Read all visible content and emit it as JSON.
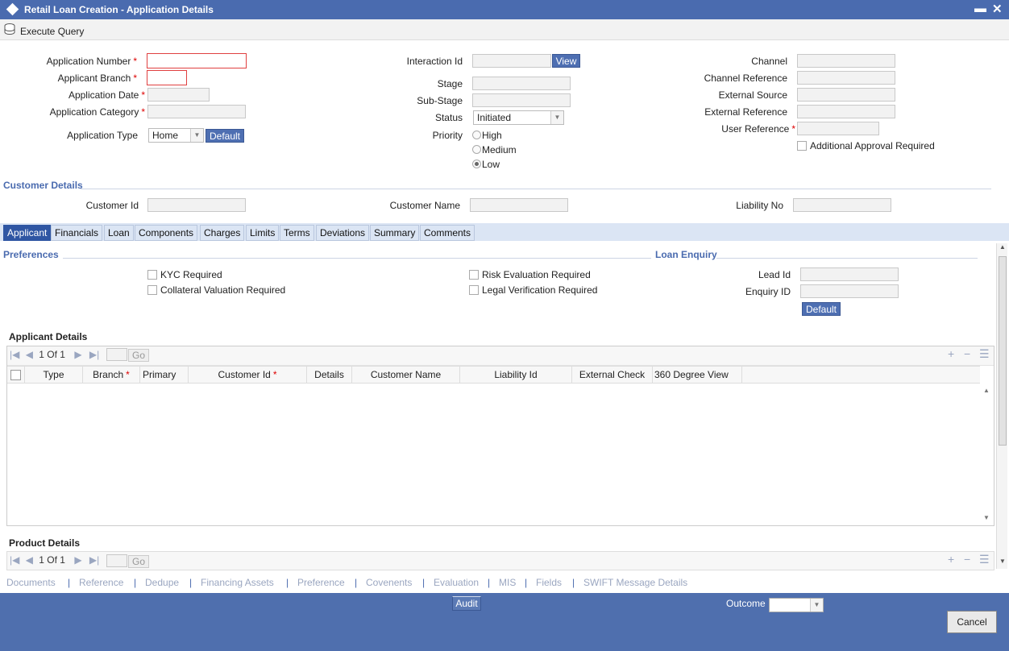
{
  "window": {
    "title": "Retail Loan Creation - Application Details",
    "minimize": "▬",
    "close": "✕"
  },
  "toolbar": {
    "execute_query": "Execute Query"
  },
  "form": {
    "application_number": "Application Number",
    "applicant_branch": "Applicant Branch",
    "application_date": "Application Date",
    "application_category": "Application Category",
    "application_type": "Application Type",
    "application_type_value": "Home",
    "default_label": "Default",
    "interaction_id": "Interaction Id",
    "view_label": "View",
    "stage": "Stage",
    "sub_stage": "Sub-Stage",
    "status": "Status",
    "status_value": "Initiated",
    "priority": "Priority",
    "priority_options": [
      "High",
      "Medium",
      "Low"
    ],
    "priority_selected": "Low",
    "channel": "Channel",
    "channel_reference": "Channel Reference",
    "external_source": "External Source",
    "external_reference": "External Reference",
    "user_reference": "User Reference",
    "additional_approval": "Additional Approval Required",
    "required_mark": "*"
  },
  "customer": {
    "section_title": "Customer Details",
    "customer_id": "Customer Id",
    "customer_name": "Customer Name",
    "liability_no": "Liability No"
  },
  "tabs": [
    "Applicant",
    "Financials",
    "Loan",
    "Components",
    "Charges",
    "Limits",
    "Terms",
    "Deviations",
    "Summary",
    "Comments"
  ],
  "active_tab": "Applicant",
  "preferences": {
    "title": "Preferences",
    "kyc": "KYC Required",
    "collateral": "Collateral Valuation Required",
    "risk": "Risk Evaluation Required",
    "legal": "Legal Verification Required"
  },
  "loan_enquiry": {
    "title": "Loan Enquiry",
    "lead_id": "Lead Id",
    "enquiry_id": "Enquiry ID",
    "default_label": "Default"
  },
  "applicant_details": {
    "title": "Applicant Details",
    "pager": "1 Of 1",
    "go": "Go",
    "columns": [
      "Type",
      "Branch",
      "Primary",
      "Customer Id",
      "Details",
      "Customer Name",
      "Liability Id",
      "External Check",
      "360 Degree View"
    ]
  },
  "product_details": {
    "title": "Product Details",
    "pager": "1 Of 1",
    "go": "Go"
  },
  "bottom_links": [
    "Documents",
    "Reference",
    "Dedupe",
    "Financing Assets",
    "Preference",
    "Covenents",
    "Evaluation",
    "MIS",
    "Fields",
    "SWIFT Message Details"
  ],
  "footer": {
    "audit": "Audit",
    "outcome": "Outcome",
    "cancel": "Cancel"
  },
  "colors": {
    "titlebar": "#4a6baf",
    "tab_active": "#2f56a3",
    "footer": "#4f6fae",
    "required": "#dd0000"
  }
}
